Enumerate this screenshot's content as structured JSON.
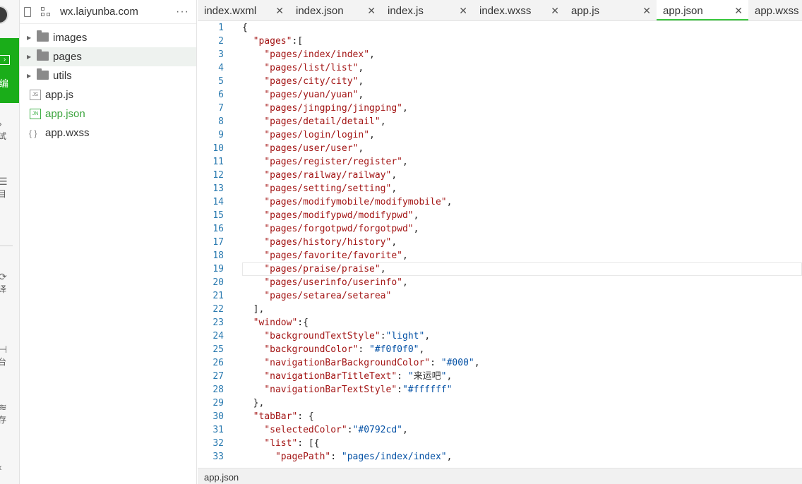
{
  "activity": {
    "editor_label": "编",
    "items": [
      {
        "name": "debug",
        "glyph": "›",
        "label": "试"
      },
      {
        "name": "project",
        "glyph": "☰",
        "label": "目"
      },
      {
        "name": "translate",
        "glyph": "⟳",
        "label": "译"
      },
      {
        "name": "platform",
        "glyph": "⊣",
        "label": "台"
      },
      {
        "name": "cache",
        "glyph": "≋",
        "label": "存"
      },
      {
        "name": "back",
        "glyph": "‹",
        "label": ""
      }
    ]
  },
  "explorer": {
    "project_name": "wx.laiyunba.com",
    "more_label": "···",
    "items": [
      {
        "type": "folder",
        "label": "images"
      },
      {
        "type": "folder",
        "label": "pages"
      },
      {
        "type": "folder",
        "label": "utils"
      },
      {
        "type": "js",
        "badge": "JS",
        "label": "app.js"
      },
      {
        "type": "json",
        "badge": "JN",
        "label": "app.json"
      },
      {
        "type": "wxss",
        "badge": "{ }",
        "label": "app.wxss"
      }
    ]
  },
  "tabs": [
    {
      "label": "index.wxml",
      "close": "✕"
    },
    {
      "label": "index.json",
      "close": "✕"
    },
    {
      "label": "index.js",
      "close": "✕"
    },
    {
      "label": "index.wxss",
      "close": "✕"
    },
    {
      "label": "app.js",
      "close": "✕"
    },
    {
      "label": "app.json",
      "close": "✕"
    },
    {
      "label": "app.wxss",
      "close": ""
    }
  ],
  "active_tab": "app.json",
  "editor": {
    "current_line": 19,
    "lines": [
      [
        [
          "p",
          "{"
        ]
      ],
      [
        [
          "p",
          "  "
        ],
        [
          "k",
          "\"pages\""
        ],
        [
          "p",
          ":["
        ]
      ],
      [
        [
          "p",
          "    "
        ],
        [
          "k",
          "\"pages/index/index\""
        ],
        [
          "p",
          ","
        ]
      ],
      [
        [
          "p",
          "    "
        ],
        [
          "k",
          "\"pages/list/list\""
        ],
        [
          "p",
          ","
        ]
      ],
      [
        [
          "p",
          "    "
        ],
        [
          "k",
          "\"pages/city/city\""
        ],
        [
          "p",
          ","
        ]
      ],
      [
        [
          "p",
          "    "
        ],
        [
          "k",
          "\"pages/yuan/yuan\""
        ],
        [
          "p",
          ","
        ]
      ],
      [
        [
          "p",
          "    "
        ],
        [
          "k",
          "\"pages/jingping/jingping\""
        ],
        [
          "p",
          ","
        ]
      ],
      [
        [
          "p",
          "    "
        ],
        [
          "k",
          "\"pages/detail/detail\""
        ],
        [
          "p",
          ","
        ]
      ],
      [
        [
          "p",
          "    "
        ],
        [
          "k",
          "\"pages/login/login\""
        ],
        [
          "p",
          ","
        ]
      ],
      [
        [
          "p",
          "    "
        ],
        [
          "k",
          "\"pages/user/user\""
        ],
        [
          "p",
          ","
        ]
      ],
      [
        [
          "p",
          "    "
        ],
        [
          "k",
          "\"pages/register/register\""
        ],
        [
          "p",
          ","
        ]
      ],
      [
        [
          "p",
          "    "
        ],
        [
          "k",
          "\"pages/railway/railway\""
        ],
        [
          "p",
          ","
        ]
      ],
      [
        [
          "p",
          "    "
        ],
        [
          "k",
          "\"pages/setting/setting\""
        ],
        [
          "p",
          ","
        ]
      ],
      [
        [
          "p",
          "    "
        ],
        [
          "k",
          "\"pages/modifymobile/modifymobile\""
        ],
        [
          "p",
          ","
        ]
      ],
      [
        [
          "p",
          "    "
        ],
        [
          "k",
          "\"pages/modifypwd/modifypwd\""
        ],
        [
          "p",
          ","
        ]
      ],
      [
        [
          "p",
          "    "
        ],
        [
          "k",
          "\"pages/forgotpwd/forgotpwd\""
        ],
        [
          "p",
          ","
        ]
      ],
      [
        [
          "p",
          "    "
        ],
        [
          "k",
          "\"pages/history/history\""
        ],
        [
          "p",
          ","
        ]
      ],
      [
        [
          "p",
          "    "
        ],
        [
          "k",
          "\"pages/favorite/favorite\""
        ],
        [
          "p",
          ","
        ]
      ],
      [
        [
          "p",
          "    "
        ],
        [
          "k",
          "\"pages/praise/praise\""
        ],
        [
          "p",
          ","
        ]
      ],
      [
        [
          "p",
          "    "
        ],
        [
          "k",
          "\"pages/userinfo/userinfo\""
        ],
        [
          "p",
          ","
        ]
      ],
      [
        [
          "p",
          "    "
        ],
        [
          "k",
          "\"pages/setarea/setarea\""
        ]
      ],
      [
        [
          "p",
          "  ],"
        ]
      ],
      [
        [
          "p",
          "  "
        ],
        [
          "k",
          "\"window\""
        ],
        [
          "p",
          ":{"
        ]
      ],
      [
        [
          "p",
          "    "
        ],
        [
          "k",
          "\"backgroundTextStyle\""
        ],
        [
          "p",
          ":"
        ],
        [
          "s",
          "\"light\""
        ],
        [
          "p",
          ","
        ]
      ],
      [
        [
          "p",
          "    "
        ],
        [
          "k",
          "\"backgroundColor\""
        ],
        [
          "p",
          ": "
        ],
        [
          "s",
          "\"#f0f0f0\""
        ],
        [
          "p",
          ","
        ]
      ],
      [
        [
          "p",
          "    "
        ],
        [
          "k",
          "\"navigationBarBackgroundColor\""
        ],
        [
          "p",
          ": "
        ],
        [
          "s",
          "\"#000\""
        ],
        [
          "p",
          ","
        ]
      ],
      [
        [
          "p",
          "    "
        ],
        [
          "k",
          "\"navigationBarTitleText\""
        ],
        [
          "p",
          ": "
        ],
        [
          "s",
          "\""
        ],
        [
          "cjk",
          "来运吧"
        ],
        [
          "s",
          "\""
        ],
        [
          "p",
          ","
        ]
      ],
      [
        [
          "p",
          "    "
        ],
        [
          "k",
          "\"navigationBarTextStyle\""
        ],
        [
          "p",
          ":"
        ],
        [
          "s",
          "\"#ffffff\""
        ]
      ],
      [
        [
          "p",
          "  },"
        ]
      ],
      [
        [
          "p",
          "  "
        ],
        [
          "k",
          "\"tabBar\""
        ],
        [
          "p",
          ": {"
        ]
      ],
      [
        [
          "p",
          "    "
        ],
        [
          "k",
          "\"selectedColor\""
        ],
        [
          "p",
          ":"
        ],
        [
          "s",
          "\"#0792cd\""
        ],
        [
          "p",
          ","
        ]
      ],
      [
        [
          "p",
          "    "
        ],
        [
          "k",
          "\"list\""
        ],
        [
          "p",
          ": [{"
        ]
      ],
      [
        [
          "p",
          "      "
        ],
        [
          "k",
          "\"pagePath\""
        ],
        [
          "p",
          ": "
        ],
        [
          "s",
          "\"pages/index/index\""
        ],
        [
          "p",
          ","
        ]
      ]
    ]
  },
  "status_bar": {
    "file": "app.json"
  },
  "colors": {
    "accent": "#1aad19",
    "active_tab_underline": "#3ac73e",
    "key": "#a31515",
    "string": "#0451a5",
    "line_number": "#2a7ab0"
  }
}
